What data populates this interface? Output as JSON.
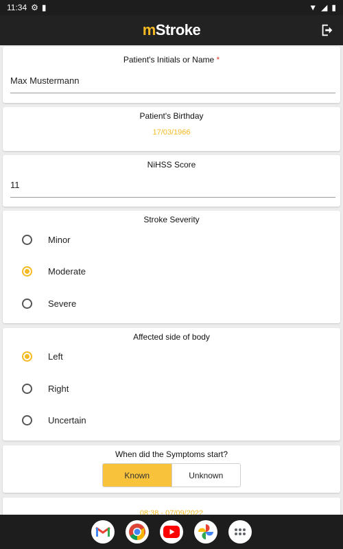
{
  "status_bar": {
    "time": "11:34"
  },
  "app_bar": {
    "logo_m": "m",
    "logo_rest": "Stroke"
  },
  "patient_name": {
    "label": "Patient's Initials or Name",
    "required_mark": "*",
    "value": "Max Mustermann"
  },
  "birthday": {
    "label": "Patient's Birthday",
    "value": "17/03/1966"
  },
  "nihss": {
    "label": "NiHSS Score",
    "value": "11"
  },
  "severity": {
    "label": "Stroke Severity",
    "options": [
      {
        "label": "Minor",
        "checked": false
      },
      {
        "label": "Moderate",
        "checked": true
      },
      {
        "label": "Severe",
        "checked": false
      }
    ]
  },
  "affected_side": {
    "label": "Affected side of body",
    "options": [
      {
        "label": "Left",
        "checked": true
      },
      {
        "label": "Right",
        "checked": false
      },
      {
        "label": "Uncertain",
        "checked": false
      }
    ]
  },
  "symptom_start": {
    "label": "When did the Symptoms start?",
    "known_label": "Known",
    "unknown_label": "Unknown",
    "selected": "Known",
    "partial_datetime": "08:38 - 07/09/2022"
  },
  "colors": {
    "accent": "#f5b922",
    "appbar": "#222222",
    "required": "#e03a2b"
  },
  "nav_apps": [
    "gmail-icon",
    "chrome-icon",
    "youtube-icon",
    "photos-icon",
    "app-drawer-icon"
  ]
}
